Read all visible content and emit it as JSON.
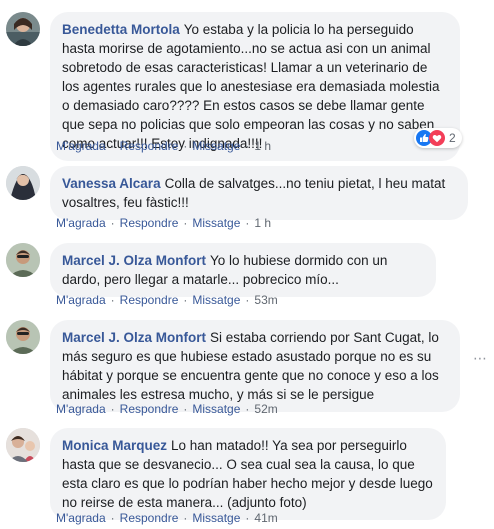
{
  "comments": [
    {
      "author": "Benedetta Mortola",
      "text": "Yo estaba y la policia lo ha perseguido hasta morirse de agotamiento...no se actua asi con un animal sobretodo de esas caracteristicas! Llamar a un veterinario de los agentes rurales que lo anestesiase era demasiada molestia o demasiado caro???? En estos casos se debe llamar gente que sepa no policias que solo empeoran las cosas y no saben como actuar!!! Estoy indignada!!!!",
      "like_label": "M'agrada",
      "reply_label": "Respondre",
      "message_label": "Missatge",
      "time": "1 h",
      "reaction_count": "2",
      "reaction_icons": [
        "like-reaction-icon",
        "love-reaction-icon"
      ]
    },
    {
      "author": "Vanessa Alcara",
      "text": "Colla de salvatges...no teniu pietat, l heu matat vosaltres, feu fàstic!!!",
      "like_label": "M'agrada",
      "reply_label": "Respondre",
      "message_label": "Missatge",
      "time": "1 h"
    },
    {
      "author": "Marcel J. Olza Monfort",
      "text": "Yo lo hubiese dormido con un dardo, pero llegar a matarle... pobrecico mío...",
      "like_label": "M'agrada",
      "reply_label": "Respondre",
      "message_label": "Missatge",
      "time": "53m"
    },
    {
      "author": "Marcel J. Olza Monfort",
      "text": "Si estaba corriendo por Sant Cugat, lo más seguro es que hubiese estado asustado porque no es su hábitat y porque se encuentra gente que no conoce y eso a los animales les estresa mucho, y más si se le persigue",
      "like_label": "M'agrada",
      "reply_label": "Respondre",
      "message_label": "Missatge",
      "time": "52m",
      "more_icon": "more-options-icon"
    },
    {
      "author": "Monica Marquez",
      "text": "Lo han matado!! Ya sea por perseguirlo hasta que se desvanecio... O sea cual sea la causa, lo que esta claro es que lo podrían haber hecho mejor y desde luego no reirse de esta manera... (adjunto foto)",
      "like_label": "M'agrada",
      "reply_label": "Respondre",
      "message_label": "Missatge",
      "time": "41m"
    }
  ],
  "colors": {
    "author": "#385898",
    "bubble": "#f2f3f5",
    "meta": "#606770",
    "like_blue": "#1877f2",
    "love_red": "#f33e58"
  }
}
